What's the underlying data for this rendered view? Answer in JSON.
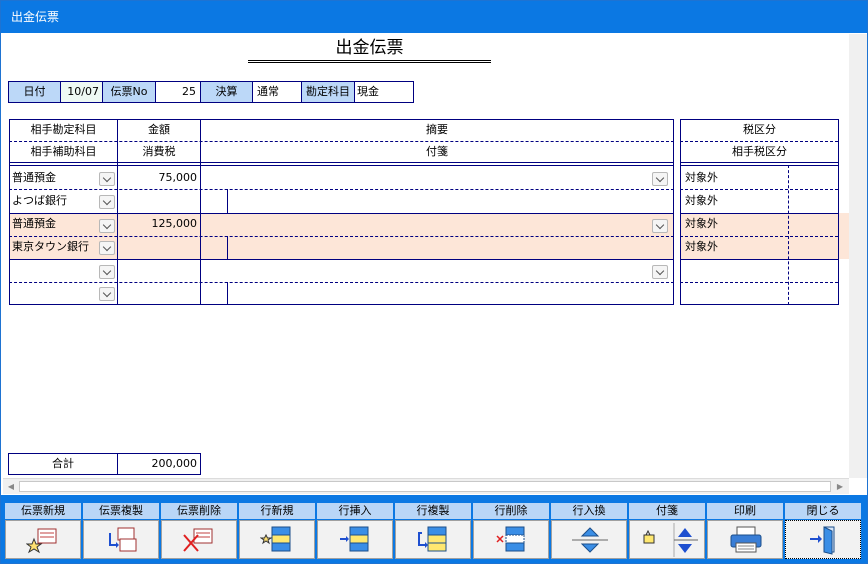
{
  "window": {
    "title": "出金伝票"
  },
  "document_title": "出金伝票",
  "header": {
    "date_label": "日付",
    "date_value": "10/07",
    "slip_no_label": "伝票No",
    "slip_no_value": "25",
    "settlement_label": "決算",
    "settlement_value": "通常",
    "account_label": "勘定科目",
    "account_value": "現金"
  },
  "columns": {
    "counter_account": "相手勘定科目",
    "counter_sub_account": "相手補助科目",
    "amount": "金額",
    "consumption_tax": "消費税",
    "summary": "摘要",
    "sticky_note": "付箋",
    "tax_category": "税区分",
    "counter_tax_category": "相手税区分"
  },
  "rows": [
    {
      "account": "普通預金",
      "sub_account": "よつば銀行",
      "amount": "75,000",
      "tax": "",
      "summary": "",
      "tax_category": "対象外",
      "counter_tax_category": "対象外",
      "highlighted": false
    },
    {
      "account": "普通預金",
      "sub_account": "東京タウン銀行",
      "amount": "125,000",
      "tax": "",
      "summary": "",
      "tax_category": "対象外",
      "counter_tax_category": "対象外",
      "highlighted": true
    },
    {
      "account": "",
      "sub_account": "",
      "amount": "",
      "tax": "",
      "summary": "",
      "tax_category": "",
      "counter_tax_category": "",
      "highlighted": false
    }
  ],
  "total": {
    "label": "合計",
    "value": "200,000"
  },
  "toolbar": {
    "new_slip": "伝票新規",
    "copy_slip": "伝票複製",
    "delete_slip": "伝票削除",
    "new_row": "行新規",
    "insert_row": "行挿入",
    "copy_row": "行複製",
    "delete_row": "行削除",
    "swap_row": "行入換",
    "sticky": "付箋",
    "print": "印刷",
    "close": "閉じる"
  },
  "colors": {
    "titlebar": "#0b78e3",
    "label_bg": "#bcd8f8",
    "highlight": "#fde6d8",
    "grid": "#000080"
  }
}
